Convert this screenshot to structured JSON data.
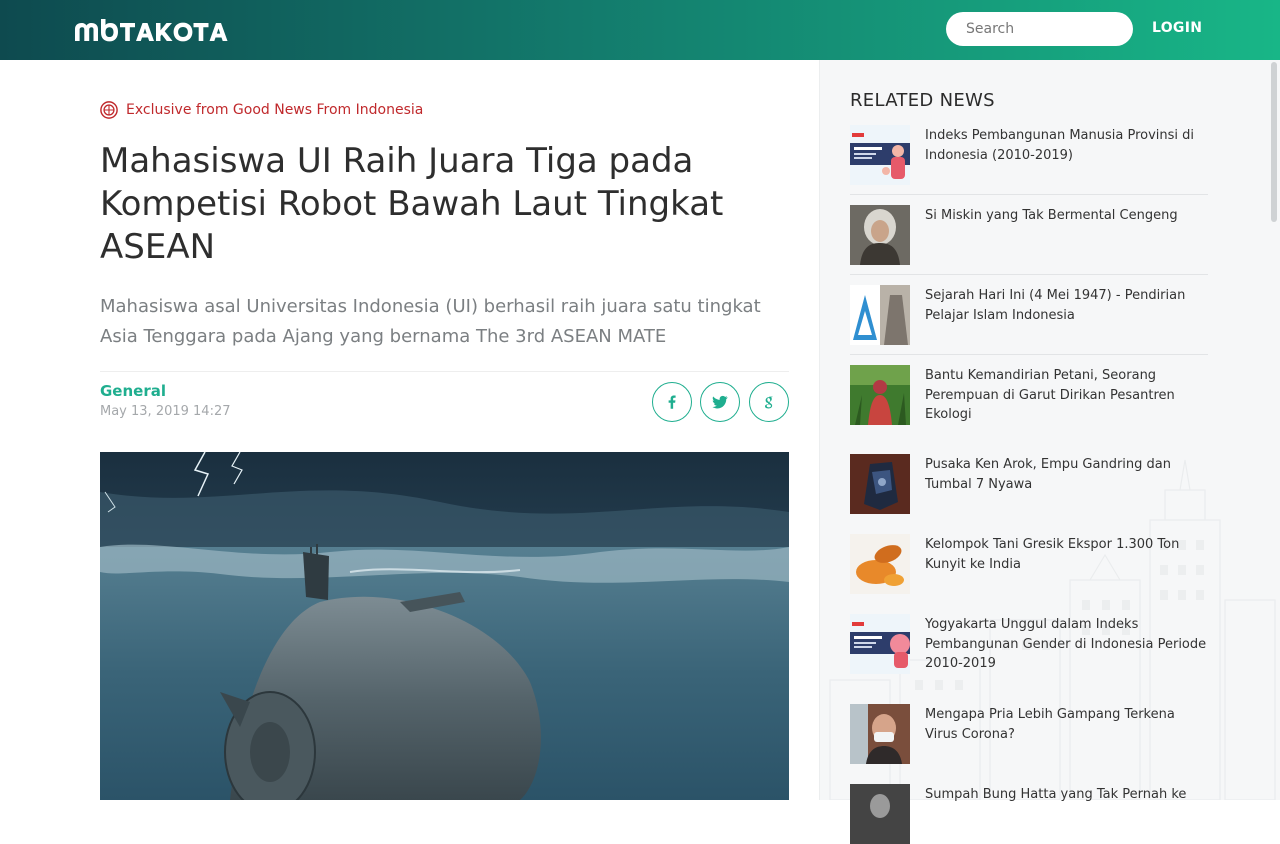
{
  "header": {
    "logo_text": "mbTAKOTA",
    "search_placeholder": "Search",
    "login_label": "LOGIN"
  },
  "article": {
    "exclusive_label": "Exclusive from Good News From Indonesia",
    "title": "Mahasiswa UI Raih Juara Tiga pada Kompetisi Robot Bawah Laut Tingkat ASEAN",
    "subtitle": "Mahasiswa asal Universitas Indonesia (UI) berhasil raih juara satu tingkat Asia Tenggara pada Ajang yang bernama The 3rd ASEAN MATE",
    "category": "General",
    "date": "May 13, 2019 14:27",
    "share_icons": [
      "facebook-icon",
      "twitter-icon",
      "google-icon"
    ]
  },
  "related": {
    "heading": "RELATED NEWS",
    "items": [
      {
        "title": "Indeks Pembangunan Manusia Provinsi di Indonesia (2010-2019)"
      },
      {
        "title": "Si Miskin yang Tak Bermental Cengeng"
      },
      {
        "title": "Sejarah Hari Ini (4 Mei 1947) - Pendirian Pelajar Islam Indonesia"
      },
      {
        "title": "Bantu Kemandirian Petani, Seorang Perempuan di Garut Dirikan Pesantren Ekologi"
      },
      {
        "title": "Pusaka Ken Arok, Empu Gandring dan Tumbal 7 Nyawa"
      },
      {
        "title": "Kelompok Tani Gresik Ekspor 1.300 Ton Kunyit ke India"
      },
      {
        "title": "Yogyakarta Unggul dalam Indeks Pembangunan Gender di Indonesia Periode 2010-2019"
      },
      {
        "title": "Mengapa Pria Lebih Gampang Terkena Virus Corona?"
      },
      {
        "title": "Sumpah Bung Hatta yang Tak Pernah ke"
      }
    ]
  },
  "colors": {
    "accent": "#1fae8f",
    "header_dark": "#0e4a4f",
    "header_light": "#18b687",
    "exclusive_red": "#c0292c"
  }
}
